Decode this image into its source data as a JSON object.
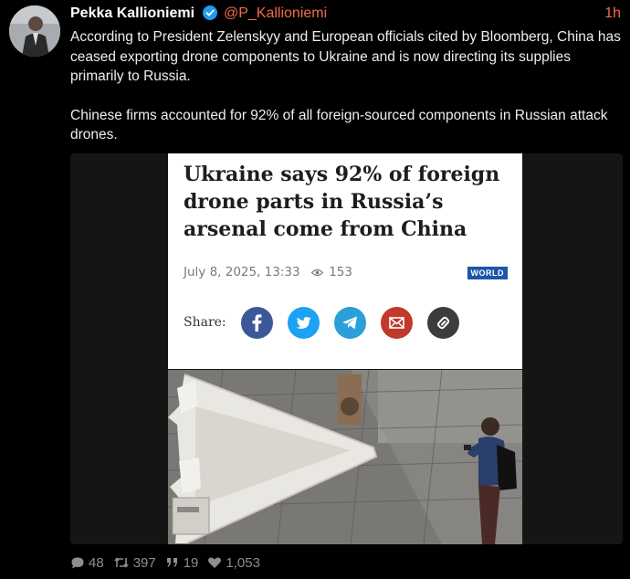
{
  "post": {
    "author_name": "Pekka Kallioniemi",
    "author_handle": "@P_Kallioniemi",
    "time": "1h",
    "paragraphs": [
      "According to President Zelenskyy and European officials cited by Bloomberg, China has ceased exporting drone components to Ukraine and is now directing its supplies primarily to Russia.",
      "Chinese firms accounted for 92% of all foreign-sourced components in Russian attack drones."
    ]
  },
  "article": {
    "headline": "Ukraine says 92% of foreign drone parts in Russia’s arsenal come from China",
    "date": "July 8, 2025, 13:33",
    "views": "153",
    "tag": "WORLD",
    "share_label": "Share:",
    "share_icons": [
      "facebook-icon",
      "twitter-icon",
      "telegram-icon",
      "email-icon",
      "link-icon"
    ],
    "share_colors": [
      "#3b5998",
      "#1da1f2",
      "#2b9fd8",
      "#c0392b",
      "#3c3c3c"
    ]
  },
  "stats": {
    "replies": "48",
    "reposts": "397",
    "quotes": "19",
    "likes": "1,053"
  },
  "colors": {
    "background": "#000000",
    "accent": "#f26a4b",
    "verified": "#1d9bf0"
  }
}
